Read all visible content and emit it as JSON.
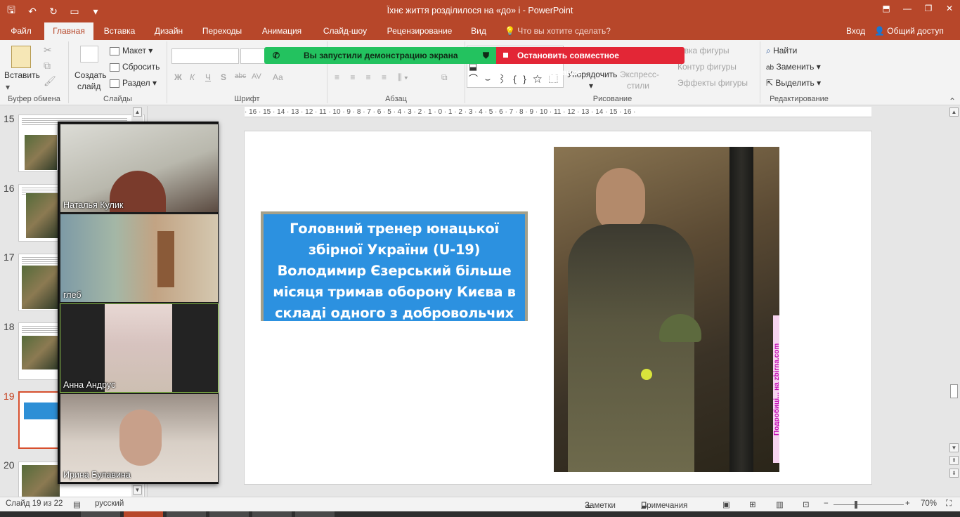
{
  "app": {
    "title": "Їхнє життя розділилося на «до» і - PowerPoint"
  },
  "tabs": {
    "file": "Файл",
    "home": "Главная",
    "insert": "Вставка",
    "design": "Дизайн",
    "transitions": "Переходы",
    "animation": "Анимация",
    "slideshow": "Слайд-шоу",
    "review": "Рецензирование",
    "view": "Вид",
    "tellme": "Что вы хотите сделать?",
    "signin": "Вход",
    "share": "Общий доступ"
  },
  "ribbon": {
    "paste": "Вставить",
    "clipboard_group": "Буфер обмена",
    "new_slide_line1": "Создать",
    "new_slide_line2": "слайд",
    "layout": "Макет",
    "reset": "Сбросить",
    "section": "Раздел",
    "slides_group": "Слайды",
    "bold": "Ж",
    "italic": "К",
    "underline": "Ч",
    "shadow": "S",
    "strike": "abc",
    "spacing": "AV",
    "case": "Aa",
    "font_group": "Шрифт",
    "paragraph_group": "Абзац",
    "arrange_line1": "Упорядочить",
    "quick_styles_line1": "Экспресс-",
    "quick_styles_line2": "стили",
    "shape_fill": "Заливка фигуры",
    "shape_outline": "Контур фигуры",
    "shape_effects": "Эффекты фигуры",
    "drawing_group": "Рисование",
    "find": "Найти",
    "replace": "Заменить",
    "select": "Выделить",
    "editing_group": "Редактирование"
  },
  "share_banner": {
    "screen_share_text": "Вы запустили демонстрацию экрана",
    "stop_text": "Остановить совместное использование"
  },
  "thumbnails": [
    {
      "number": "15"
    },
    {
      "number": "16"
    },
    {
      "number": "17"
    },
    {
      "number": "18"
    },
    {
      "number": "19"
    },
    {
      "number": "20"
    }
  ],
  "participants": [
    {
      "name": "Наталья Кулик"
    },
    {
      "name": "глеб"
    },
    {
      "name": "Анна Андрус"
    },
    {
      "name": "Ирина Булавина"
    }
  ],
  "ruler_text": "· 16 · 15 · 14 · 13 · 12 · 11 · 10 · 9 · 8 · 7 · 6 · 5 · 4 · 3 · 2 · 1 · 0 · 1 · 2 · 3 · 4 · 5 · 6 · 7 · 8 · 9 · 10 · 11 · 12 · 13 · 14 · 15 · 16 ·",
  "slide": {
    "caption": "Головний тренер юнацької збірної України (U-19) Володимир Єзерський більше місяця тримав оборону Києва в складі одного з добровольчих батальйонів",
    "side_text": "Подробиці... на zbirna.com"
  },
  "status": {
    "slide_counter": "Слайд 19 из 22",
    "language": "русский",
    "notes": "Заметки",
    "comments": "Примечания",
    "zoom": "70%"
  }
}
